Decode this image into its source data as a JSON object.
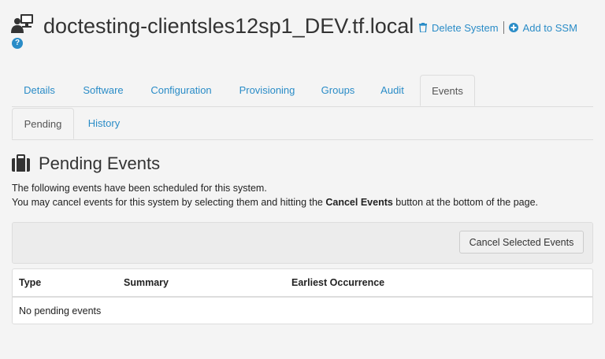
{
  "header": {
    "title": "doctesting-clientsles12sp1_DEV.tf.local",
    "actions": {
      "delete_label": "Delete System",
      "ssm_label": "Add to SSM"
    }
  },
  "tabs_primary": [
    "Details",
    "Software",
    "Configuration",
    "Provisioning",
    "Groups",
    "Audit",
    "Events"
  ],
  "tabs_primary_active": "Events",
  "tabs_secondary": [
    "Pending",
    "History"
  ],
  "tabs_secondary_active": "Pending",
  "section": {
    "title": "Pending Events",
    "line1": "The following events have been scheduled for this system.",
    "line2_prefix": "You may cancel events for this system by selecting them and hitting the ",
    "line2_bold": "Cancel Events",
    "line2_suffix": " button at the bottom of the page."
  },
  "toolbar": {
    "cancel_button": "Cancel Selected Events"
  },
  "table": {
    "columns": [
      "Type",
      "Summary",
      "Earliest Occurrence"
    ],
    "empty_text": "No pending events"
  },
  "colors": {
    "link": "#2a8cc7",
    "background": "#f4f4f4"
  },
  "icons": {
    "host": "server-computer-icon",
    "help": "question-circle-icon",
    "delete": "trash-icon",
    "add": "plus-circle-icon",
    "section": "suitcase-icon"
  }
}
